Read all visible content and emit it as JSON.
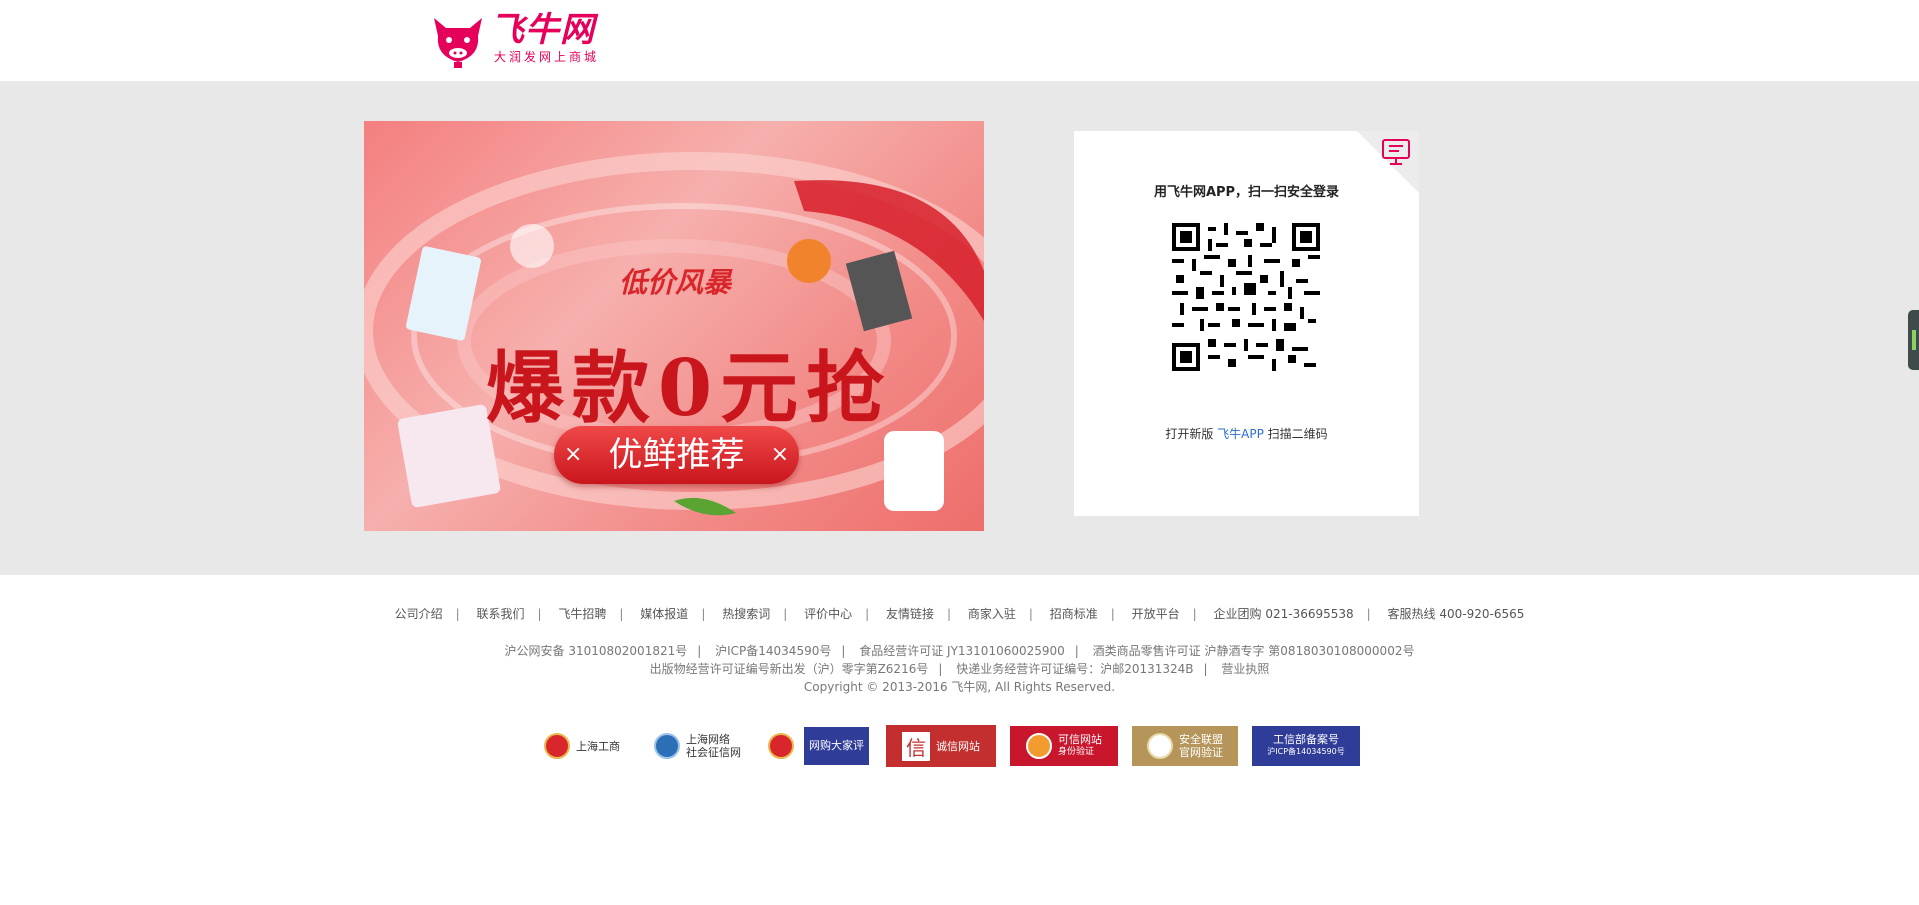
{
  "header": {
    "logo_name": "飞牛网",
    "logo_slogan": "大润发网上商城"
  },
  "banner": {
    "tagline": "低价风暴",
    "headline": "爆款0元抢",
    "button_label": "优鲜推荐",
    "button_x": "×"
  },
  "login": {
    "title": "用飞牛网APP，扫一扫安全登录",
    "hint_prefix": "打开新版",
    "hint_app": "飞牛APP",
    "hint_suffix": "扫描二维码",
    "icon": "pc-monitor-icon"
  },
  "footer": {
    "nav": [
      {
        "label": "公司介绍"
      },
      {
        "label": "联系我们"
      },
      {
        "label": "飞牛招聘"
      },
      {
        "label": "媒体报道"
      },
      {
        "label": "热搜索词"
      },
      {
        "label": "评价中心"
      },
      {
        "label": "友情链接"
      },
      {
        "label": "商家入驻"
      },
      {
        "label": "招商标准"
      },
      {
        "label": "开放平台"
      },
      {
        "label": "企业团购 021-36695538"
      },
      {
        "label": "客服热线 400-920-6565"
      }
    ],
    "legal_line1": [
      "沪公网安备 310108020018​21号",
      "沪ICP备14034590号",
      "食品经营许可证 JY13101060025900",
      "酒类商品零售许可证 沪静酒专字 第0818030108000002号"
    ],
    "legal_line2": [
      "出版物经营许可证编号新出发（沪）零字第Z6216号",
      "快递业务经营许可证编号：沪邮20131324B",
      "营业执照"
    ],
    "copyright": "Copyright © 2013-2016 飞牛网, All Rights Reserved.",
    "badges": {
      "shanghai_gs": "上海工商",
      "net_credit_1": "上海网络",
      "net_credit_2": "社会征信网",
      "dajiaping": "网购大家评",
      "chengxin_char": "信",
      "chengxin": "诚信网站",
      "kexin_1": "可信网站",
      "kexin_2": "身份验证",
      "anquan_1": "安全联盟",
      "anquan_2": "官网验证",
      "gongxin_1": "工信部备案号",
      "gongxin_2": "沪ICP备14034590号"
    }
  },
  "colors": {
    "brand": "#e5005a",
    "band": "#e8e8e8",
    "link_blue": "#2b6cd3"
  }
}
